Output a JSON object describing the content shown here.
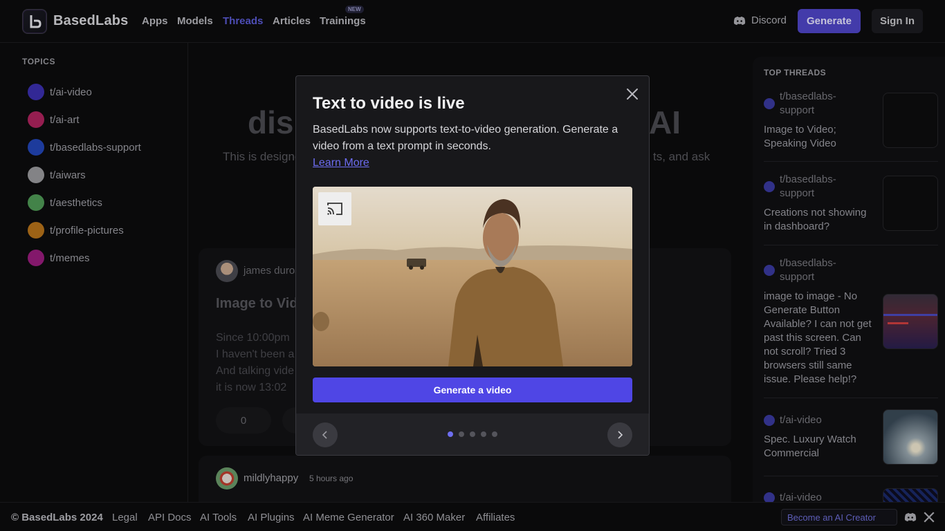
{
  "header": {
    "brand": "BasedLabs",
    "nav": [
      "Apps",
      "Models",
      "Threads",
      "Articles",
      "Trainings"
    ],
    "new_badge": "NEW",
    "discord": "Discord",
    "generate": "Generate",
    "signin": "Sign In"
  },
  "sidebar": {
    "title": "TOPICS",
    "topics": [
      {
        "label": "t/ai-video",
        "color": "#3b2fb0"
      },
      {
        "label": "t/ai-art",
        "color": "#b0245e"
      },
      {
        "label": "t/basedlabs-support",
        "color": "#2346b8"
      },
      {
        "label": "t/aiwars",
        "color": "#9a9a9e"
      },
      {
        "label": "t/aesthetics",
        "color": "#4f9a56"
      },
      {
        "label": "t/profile-pictures",
        "color": "#b8741a"
      },
      {
        "label": "t/memes",
        "color": "#9a1d7e"
      }
    ]
  },
  "main": {
    "title_left": "dis",
    "title_right": "AI",
    "sub_left": "This is designe",
    "sub_right": "ts, and ask",
    "post1": {
      "author": "james duros",
      "title": "Image to Vid",
      "body": [
        "Since 10:00pm",
        "I haven't been a",
        "And talking vide",
        "it is now 13:02"
      ],
      "votes": "0"
    },
    "post2": {
      "author": "mildlyhappy",
      "time": "5 hours ago"
    }
  },
  "rightbar": {
    "title": "TOP THREADS",
    "threads": [
      {
        "topic": "t/basedlabs-support",
        "title": "Image to Video; Speaking Video"
      },
      {
        "topic": "t/basedlabs-support",
        "title": "Creations not showing in dashboard?"
      },
      {
        "topic": "t/basedlabs-support",
        "title": "image to image - No Generate Button Available? I can not get past this screen. Can not scroll? Tried 3 browsers still same issue. Please help!?"
      },
      {
        "topic": "t/ai-video",
        "title": "Spec. Luxury Watch Commercial"
      },
      {
        "topic": "t/ai-video",
        "title": ""
      }
    ]
  },
  "modal": {
    "title": "Text to video is live",
    "description": "BasedLabs now supports text-to-video generation. Generate a video from a text prompt in seconds.",
    "learn_more": "Learn More",
    "cta": "Generate a video",
    "slide_index": 1,
    "slide_count": 5
  },
  "footer": {
    "copyright": "© BasedLabs 2024",
    "links": [
      "Legal",
      "API Docs",
      "AI Tools",
      "AI Plugins",
      "AI Meme Generator",
      "AI 360 Maker",
      "Affiliates"
    ],
    "creator_cta": "Become an AI Creator"
  }
}
